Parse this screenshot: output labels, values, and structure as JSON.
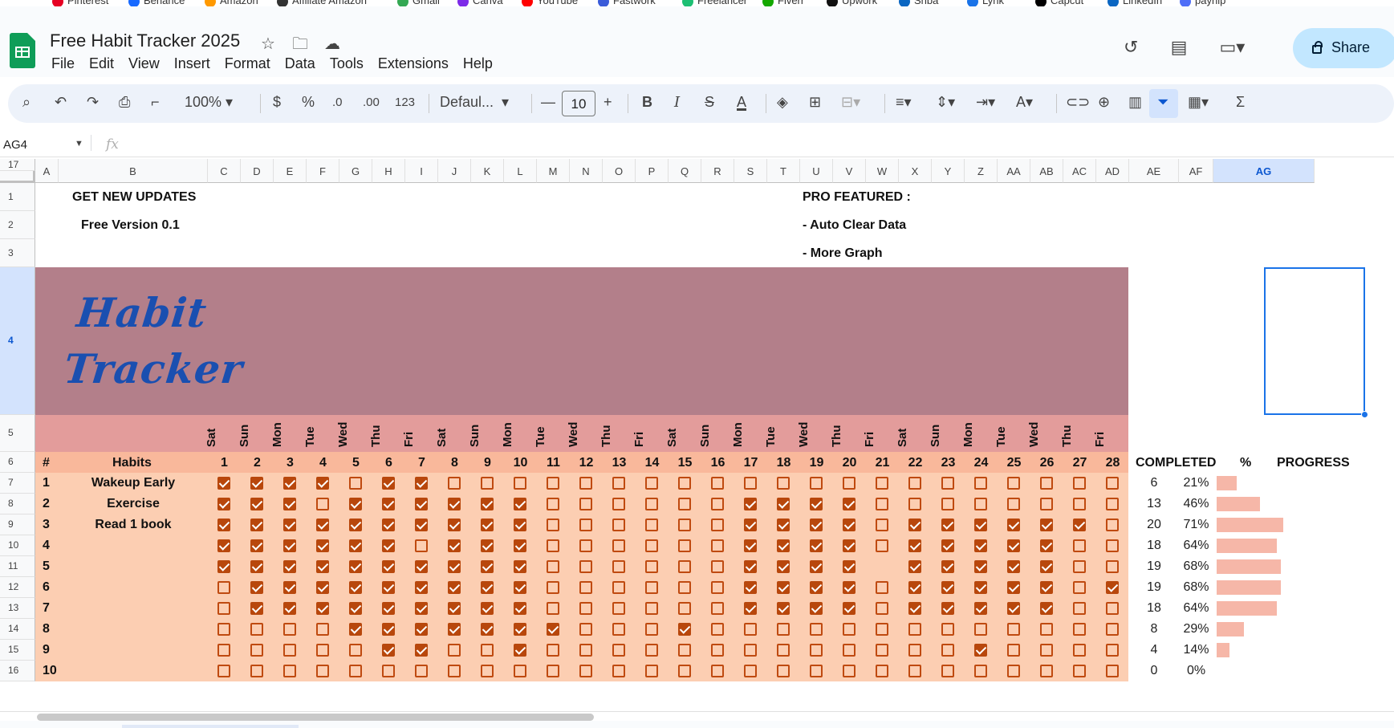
{
  "bookmarks": [
    "Pinterest",
    "Behance",
    "Amazon",
    "Affiliate Amazon",
    "Gmail",
    "Canva",
    "YouTube",
    "Fastwork",
    "Freelancer",
    "Fiverr",
    "Upwork",
    "Shba",
    "Lynk",
    "Capcut",
    "LinkedIn",
    "payhip"
  ],
  "app": {
    "doc_title": "Free Habit Tracker 2025",
    "menu": [
      "File",
      "Edit",
      "View",
      "Insert",
      "Format",
      "Data",
      "Tools",
      "Extensions",
      "Help"
    ],
    "share_label": "Share"
  },
  "toolbar": {
    "zoom": "100%",
    "currency": "$",
    "percent": "%",
    "dec_decrease": ".0",
    "dec_increase": ".00",
    "number_format": "123",
    "font": "Defaul...",
    "font_size": "10",
    "bold": "B",
    "italic": "I"
  },
  "formula_bar": {
    "name_box": "AG4",
    "fx": "fx",
    "formula": ""
  },
  "columns": [
    "A",
    "B",
    "C",
    "D",
    "E",
    "F",
    "G",
    "H",
    "I",
    "J",
    "K",
    "L",
    "M",
    "N",
    "O",
    "P",
    "Q",
    "R",
    "S",
    "T",
    "U",
    "V",
    "W",
    "X",
    "Y",
    "Z",
    "AA",
    "AB",
    "AC",
    "AD",
    "AE",
    "AF",
    "AG"
  ],
  "rows": [
    "1",
    "2",
    "3",
    "4",
    "5",
    "6",
    "7",
    "8",
    "9",
    "10",
    "11",
    "12",
    "13",
    "14",
    "15",
    "16",
    "17"
  ],
  "sheet": {
    "header_left_1": "GET NEW UPDATES",
    "header_left_2": "Free Version 0.1",
    "header_right_1": "PRO FEATURED :",
    "header_right_2": "-  Auto Clear Data",
    "header_right_3": "-  More Graph",
    "logo_line1": "Habit",
    "logo_line2": "Tracker",
    "hash_label": "#",
    "habits_label": "Habits",
    "completed_label": "COMPLETED",
    "percent_label": "%",
    "progress_label": "PROGRESS",
    "days": [
      "Sat",
      "Sun",
      "Mon",
      "Tue",
      "Wed",
      "Thu",
      "Fri",
      "Sat",
      "Sun",
      "Mon",
      "Tue",
      "Wed",
      "Thu",
      "Fri",
      "Sat",
      "Sun",
      "Mon",
      "Tue",
      "Wed",
      "Thu",
      "Fri",
      "Sat",
      "Sun",
      "Mon",
      "Tue",
      "Wed",
      "Thu",
      "Fri"
    ],
    "dates": [
      "1",
      "2",
      "3",
      "4",
      "5",
      "6",
      "7",
      "8",
      "9",
      "10",
      "11",
      "12",
      "13",
      "14",
      "15",
      "16",
      "17",
      "18",
      "19",
      "20",
      "21",
      "22",
      "23",
      "24",
      "25",
      "26",
      "27",
      "28"
    ],
    "habits": [
      {
        "num": "1",
        "name": "Wakeup Early",
        "completed": "6",
        "percent": "21%",
        "progress": 0.21,
        "checks": "1111011000000000000000000000"
      },
      {
        "num": "2",
        "name": "Exercise",
        "completed": "13",
        "percent": "46%",
        "progress": 0.46,
        "checks": "1110111111000000111100000000"
      },
      {
        "num": "3",
        "name": "Read 1 book",
        "completed": "20",
        "percent": "71%",
        "progress": 0.71,
        "checks": "1111111111000000111101111110"
      },
      {
        "num": "4",
        "name": "",
        "completed": "18",
        "percent": "64%",
        "progress": 0.64,
        "checks": "1111110111000000111101111100"
      },
      {
        "num": "5",
        "name": "",
        "completed": "19",
        "percent": "68%",
        "progress": 0.68,
        "checks": "1111111111000000111121111100"
      },
      {
        "num": "6",
        "name": "",
        "completed": "19",
        "percent": "68%",
        "progress": 0.68,
        "checks": "0111111111000000111101111101"
      },
      {
        "num": "7",
        "name": "",
        "completed": "18",
        "percent": "64%",
        "progress": 0.64,
        "checks": "0111111111000000111101111100"
      },
      {
        "num": "8",
        "name": "",
        "completed": "8",
        "percent": "29%",
        "progress": 0.29,
        "checks": "0000111111100010000000000000"
      },
      {
        "num": "9",
        "name": "",
        "completed": "4",
        "percent": "14%",
        "progress": 0.14,
        "checks": "0000011001000000000000010000"
      },
      {
        "num": "10",
        "name": "",
        "completed": "0",
        "percent": "0%",
        "progress": 0.0,
        "checks": "0000000000000000000000000000"
      }
    ]
  },
  "colors": {
    "banner": "#b37f8a",
    "day_row": "#e39c9b",
    "number_row": "#f9b89b",
    "habit_area": "#fcceb2",
    "checkbox": "#b8470c",
    "progress_bar": "#f6b7a8",
    "logo_text": "#1a4fb0",
    "share_button": "#c2e7ff"
  }
}
